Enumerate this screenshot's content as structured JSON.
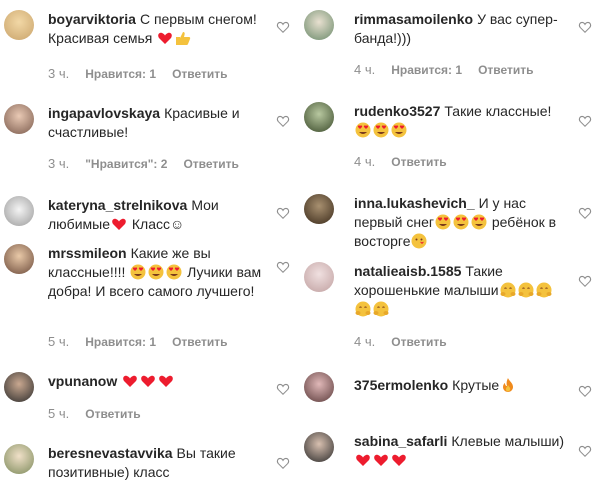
{
  "left": [
    {
      "user": "boyarviktoria",
      "text": "С первым снегом! Красивая семья",
      "emoji": "heart-thumbsup",
      "time": "3 ч.",
      "likes": "Нравится: 1",
      "reply": "Ответить"
    },
    {
      "user": "ingapavlovskaya",
      "text": "Красивые и счастливые!",
      "emoji": "",
      "time": "3 ч.",
      "likes": "\"Нравится\": 2",
      "reply": "Ответить"
    },
    {
      "user": "kateryna_strelnikova",
      "text": "Мои любимые",
      "emoji": "heart-klass",
      "time": "",
      "likes": "",
      "reply": ""
    },
    {
      "user": "mrssmileon",
      "text": "Какие же вы классные!!!!",
      "emoji": "",
      "text2": "Лучики вам добра! И всего самого лучшего!",
      "time": "5 ч.",
      "likes": "Нравится: 1",
      "reply": "Ответить"
    },
    {
      "user": "vpunanow",
      "text": "",
      "emoji": "three-hearts",
      "time": "5 ч.",
      "likes": "",
      "reply": "Ответить"
    },
    {
      "user": "beresnevastavvika",
      "text": "Вы такие позитивные) класс",
      "emoji": "",
      "time": "",
      "likes": "",
      "reply": ""
    }
  ],
  "right": [
    {
      "user": "rimmasamoilenko",
      "text": "У вас супер-банда!)))",
      "time": "4 ч.",
      "likes": "Нравится: 1",
      "reply": "Ответить"
    },
    {
      "user": "rudenko3527",
      "text": "Такие классные!",
      "time": "4 ч.",
      "likes": "",
      "reply": "Ответить"
    },
    {
      "user": "inna.lukashevich_",
      "text": "И у нас первый снег",
      "text2": "ребёнок в восторге",
      "time": "",
      "likes": "",
      "reply": ""
    },
    {
      "user": "natalieaisb.1585",
      "text": "Такие хорошенькие малыши",
      "time": "4 ч.",
      "likes": "",
      "reply": "Ответить"
    },
    {
      "user": "375ermolenko",
      "text": "Крутые",
      "time": "",
      "likes": "",
      "reply": ""
    },
    {
      "user": "sabina_safarli",
      "text": "Клевые малыши)",
      "time": "",
      "likes": "",
      "reply": ""
    }
  ],
  "klass": "Класс☺",
  "colors": {
    "accent": "#262626",
    "meta": "#8e8e8e",
    "heart": "#ed1c2e",
    "emoji": "#f4c23d"
  }
}
